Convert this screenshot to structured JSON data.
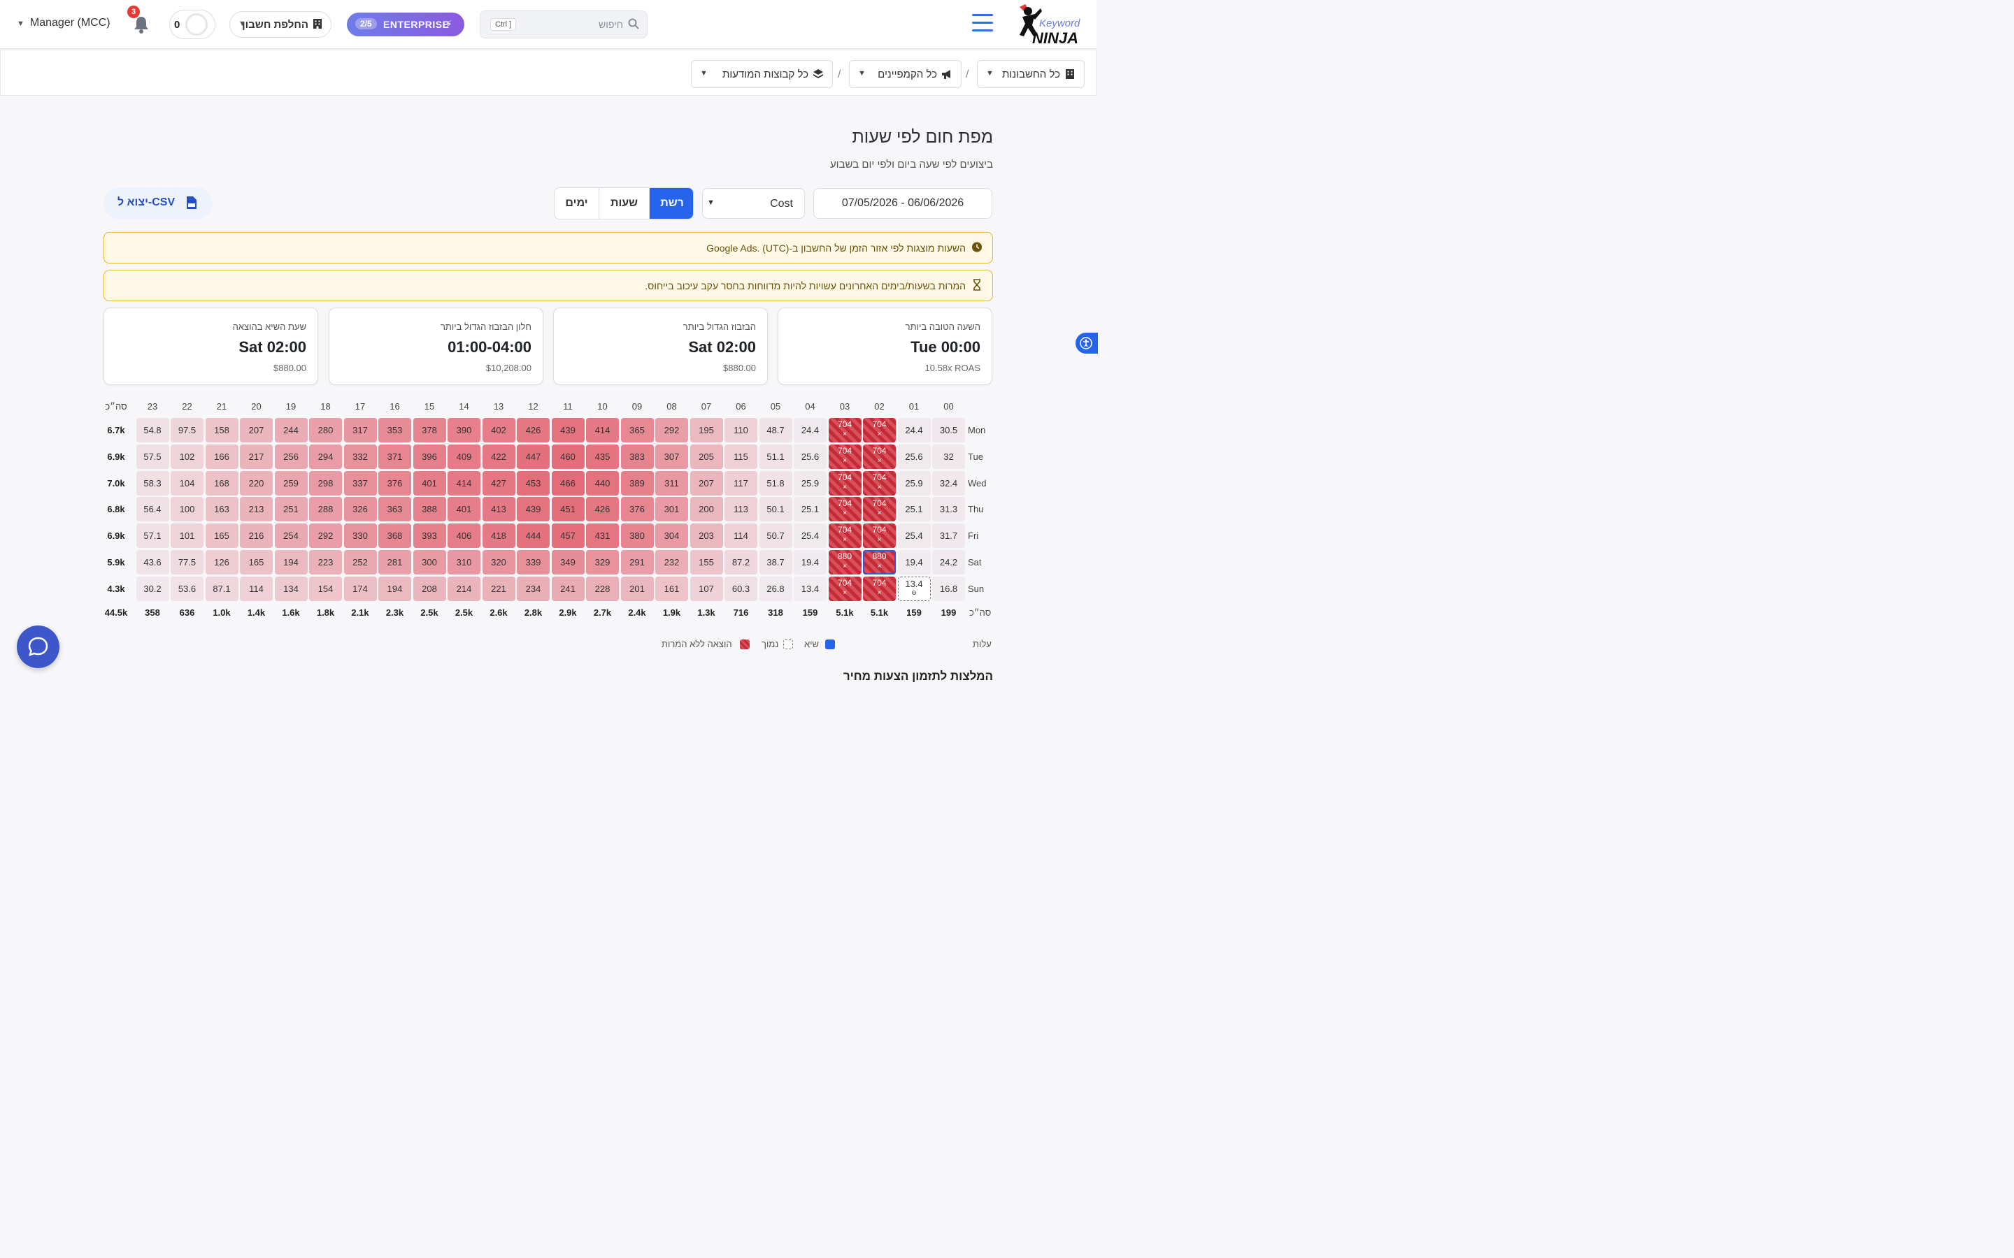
{
  "header": {
    "logo_text": "Keyword NINJA",
    "search_placeholder": "חיפוש",
    "search_shortcut": "Ctrl ]",
    "plan_badge": "2/5",
    "plan_label": "ENTERPRISE",
    "switch_account": "החלפת חשבון",
    "counter_value": "0",
    "notifications_count": "3",
    "account_name": "Manager (MCC)"
  },
  "breadcrumb": {
    "accounts": "כל החשבונות",
    "campaigns": "כל הקמפיינים",
    "adgroups": "כל קבוצות המודעות"
  },
  "page": {
    "title": "מפת חום לפי שעות",
    "subtitle": "ביצועים לפי שעה ביום ולפי יום בשבוע",
    "date_range": "07/05/2026 - 06/06/2026",
    "metric": "Cost",
    "views": [
      "ימים",
      "שעות",
      "רשת"
    ],
    "export_csv": "יצוא ל-CSV",
    "notice_tz": "השעות מוצגות לפי אזור הזמן של החשבון ב-Google Ads. (UTC)",
    "notice_delay": "המרות בשעות/בימים האחרונים עשויות להיות מדווחות בחסר עקב עיכוב בייחוס."
  },
  "cards": [
    {
      "label": "השעה הטובה ביותר",
      "value": "Tue 00:00",
      "sub": "10.58x ROAS"
    },
    {
      "label": "הבזבוז הגדול ביותר",
      "value": "Sat 02:00",
      "sub": "$880.00"
    },
    {
      "label": "חלון הבזבוז הגדול ביותר",
      "value": "01:00-04:00",
      "sub": "$10,208.00"
    },
    {
      "label": "שעת השיא בהוצאה",
      "value": "Sat 02:00",
      "sub": "$880.00"
    }
  ],
  "heatmap": {
    "hours": [
      "00",
      "01",
      "02",
      "03",
      "04",
      "05",
      "06",
      "07",
      "08",
      "09",
      "10",
      "11",
      "12",
      "13",
      "14",
      "15",
      "16",
      "17",
      "18",
      "19",
      "20",
      "21",
      "22",
      "23"
    ],
    "total_label": "סה״כ",
    "rows": [
      {
        "day": "Mon",
        "total": "6.7k",
        "values": [
          "30.5",
          "24.4",
          "704",
          "704",
          "24.4",
          "48.7",
          "110",
          "195",
          "292",
          "365",
          "414",
          "439",
          "426",
          "402",
          "390",
          "378",
          "353",
          "317",
          "280",
          "244",
          "207",
          "158",
          "97.5",
          "54.8"
        ]
      },
      {
        "day": "Tue",
        "total": "6.9k",
        "values": [
          "32",
          "25.6",
          "704",
          "704",
          "25.6",
          "51.1",
          "115",
          "205",
          "307",
          "383",
          "435",
          "460",
          "447",
          "422",
          "409",
          "396",
          "371",
          "332",
          "294",
          "256",
          "217",
          "166",
          "102",
          "57.5"
        ]
      },
      {
        "day": "Wed",
        "total": "7.0k",
        "values": [
          "32.4",
          "25.9",
          "704",
          "704",
          "25.9",
          "51.8",
          "117",
          "207",
          "311",
          "389",
          "440",
          "466",
          "453",
          "427",
          "414",
          "401",
          "376",
          "337",
          "298",
          "259",
          "220",
          "168",
          "104",
          "58.3"
        ]
      },
      {
        "day": "Thu",
        "total": "6.8k",
        "values": [
          "31.3",
          "25.1",
          "704",
          "704",
          "25.1",
          "50.1",
          "113",
          "200",
          "301",
          "376",
          "426",
          "451",
          "439",
          "413",
          "401",
          "388",
          "363",
          "326",
          "288",
          "251",
          "213",
          "163",
          "100",
          "56.4"
        ]
      },
      {
        "day": "Fri",
        "total": "6.9k",
        "values": [
          "31.7",
          "25.4",
          "704",
          "704",
          "25.4",
          "50.7",
          "114",
          "203",
          "304",
          "380",
          "431",
          "457",
          "444",
          "418",
          "406",
          "393",
          "368",
          "330",
          "292",
          "254",
          "216",
          "165",
          "101",
          "57.1"
        ]
      },
      {
        "day": "Sat",
        "total": "5.9k",
        "values": [
          "24.2",
          "19.4",
          "880",
          "880",
          "19.4",
          "38.7",
          "87.2",
          "155",
          "232",
          "291",
          "329",
          "349",
          "339",
          "320",
          "310",
          "300",
          "281",
          "252",
          "223",
          "194",
          "165",
          "126",
          "77.5",
          "43.6"
        ]
      },
      {
        "day": "Sun",
        "total": "4.3k",
        "values": [
          "16.8",
          "13.4",
          "704",
          "704",
          "13.4",
          "26.8",
          "60.3",
          "107",
          "161",
          "201",
          "228",
          "241",
          "234",
          "221",
          "214",
          "208",
          "194",
          "174",
          "154",
          "134",
          "114",
          "87.1",
          "53.6",
          "30.2"
        ]
      }
    ],
    "col_totals": [
      "199",
      "159",
      "5.1k",
      "5.1k",
      "159",
      "318",
      "716",
      "1.3k",
      "1.9k",
      "2.4k",
      "2.7k",
      "2.9k",
      "2.8k",
      "2.6k",
      "2.5k",
      "2.5k",
      "2.3k",
      "2.1k",
      "1.8k",
      "1.6k",
      "1.4k",
      "1.0k",
      "636",
      "358"
    ],
    "grand_total": "44.5k",
    "na_mark": "×",
    "low_mark": "⊖"
  },
  "legend": {
    "title": "עלות",
    "peak": "שיא",
    "low": "נמוך",
    "no_conv": "הוצאה ללא המרות"
  },
  "section_next": "המלצות לתזמון הצעות מחיר",
  "colors": {
    "accent": "#2563eb",
    "heat_max": "#e46b78",
    "no_conv": "#c52a37"
  }
}
